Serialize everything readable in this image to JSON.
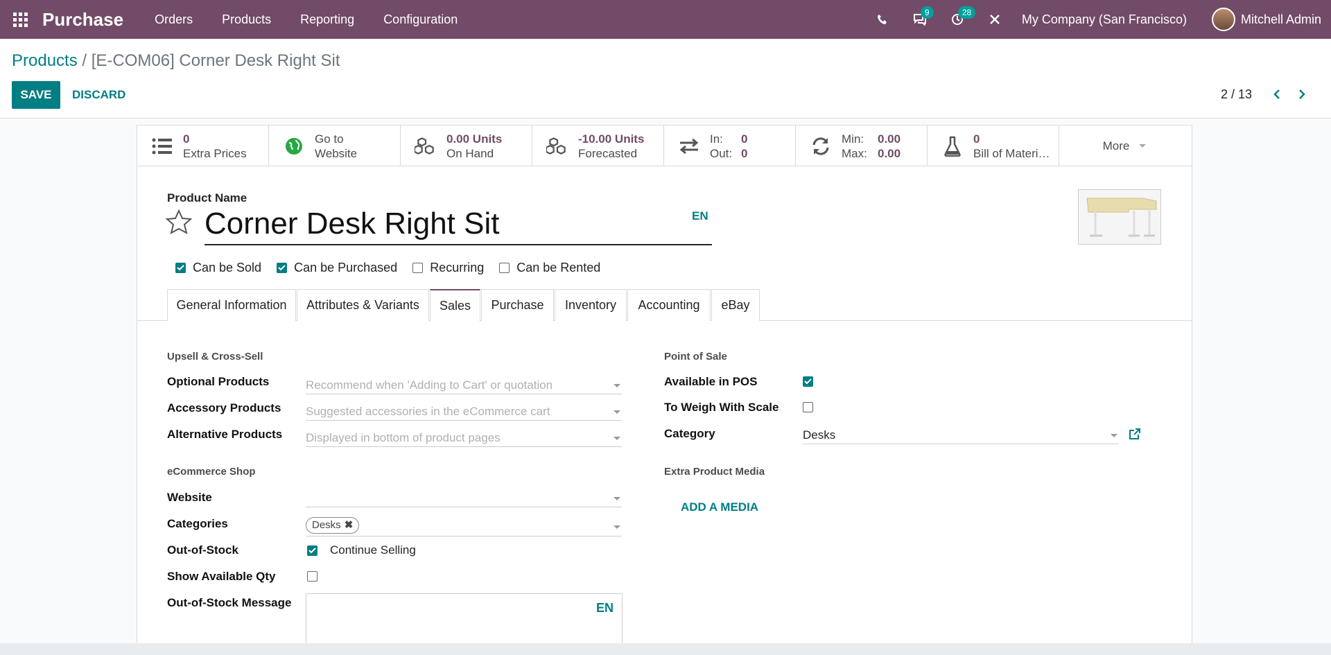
{
  "navbar": {
    "app_name": "Purchase",
    "menu": [
      "Orders",
      "Products",
      "Reporting",
      "Configuration"
    ],
    "messages_badge": "9",
    "activities_badge": "28",
    "company": "My Company (San Francisco)",
    "user": "Mitchell Admin"
  },
  "breadcrumb": {
    "parent": "Products",
    "separator": " / ",
    "current": "[E-COM06] Corner Desk Right Sit"
  },
  "actions": {
    "save": "SAVE",
    "discard": "DISCARD"
  },
  "pager": {
    "value": "2 / 13"
  },
  "smart_buttons": [
    {
      "value": "0",
      "label": "Extra Prices",
      "icon": "list-icon"
    },
    {
      "value": "Go to",
      "label": "Website",
      "icon": "globe-icon"
    },
    {
      "value": "0.00 Units",
      "label": "On Hand",
      "icon": "cubes-icon"
    },
    {
      "value": "-10.00 Units",
      "label": "Forecasted",
      "icon": "cubes-icon"
    },
    {
      "value": "In:",
      "value2": "0",
      "label": "Out:",
      "label2": "0",
      "icon": "exchange-icon"
    },
    {
      "value": "Min:",
      "value2": "0.00",
      "label": "Max:",
      "label2": "0.00",
      "icon": "refresh-icon"
    },
    {
      "value": "0",
      "label": "Bill of Materi…",
      "icon": "flask-icon"
    }
  ],
  "more": "More",
  "product": {
    "name_label": "Product Name",
    "name": "Corner Desk Right Sit",
    "lang": "EN"
  },
  "options": [
    {
      "label": "Can be Sold",
      "checked": true
    },
    {
      "label": "Can be Purchased",
      "checked": true
    },
    {
      "label": "Recurring",
      "checked": false
    },
    {
      "label": "Can be Rented",
      "checked": false
    }
  ],
  "tabs": [
    "General Information",
    "Attributes & Variants",
    "Sales",
    "Purchase",
    "Inventory",
    "Accounting",
    "eBay"
  ],
  "active_tab": "Sales",
  "sales": {
    "upsell_title": "Upsell & Cross-Sell",
    "optional_label": "Optional Products",
    "optional_placeholder": "Recommend when 'Adding to Cart' or quotation",
    "accessory_label": "Accessory Products",
    "accessory_placeholder": "Suggested accessories in the eCommerce cart",
    "alternative_label": "Alternative Products",
    "alternative_placeholder": "Displayed in bottom of product pages",
    "ecommerce_title": "eCommerce Shop",
    "website_label": "Website",
    "categories_label": "Categories",
    "category_tag": "Desks",
    "oos_label": "Out-of-Stock",
    "continue_selling": "Continue Selling",
    "show_qty_label": "Show Available Qty",
    "oos_message_label": "Out-of-Stock Message",
    "oos_message_lang": "EN",
    "pos_title": "Point of Sale",
    "available_pos_label": "Available in POS",
    "weigh_label": "To Weigh With Scale",
    "category_label": "Category",
    "category_value": "Desks",
    "media_title": "Extra Product Media",
    "add_media": "ADD A MEDIA"
  },
  "colors": {
    "brand": "#714b67",
    "accent": "#017e84",
    "badge": "#00a09d"
  }
}
